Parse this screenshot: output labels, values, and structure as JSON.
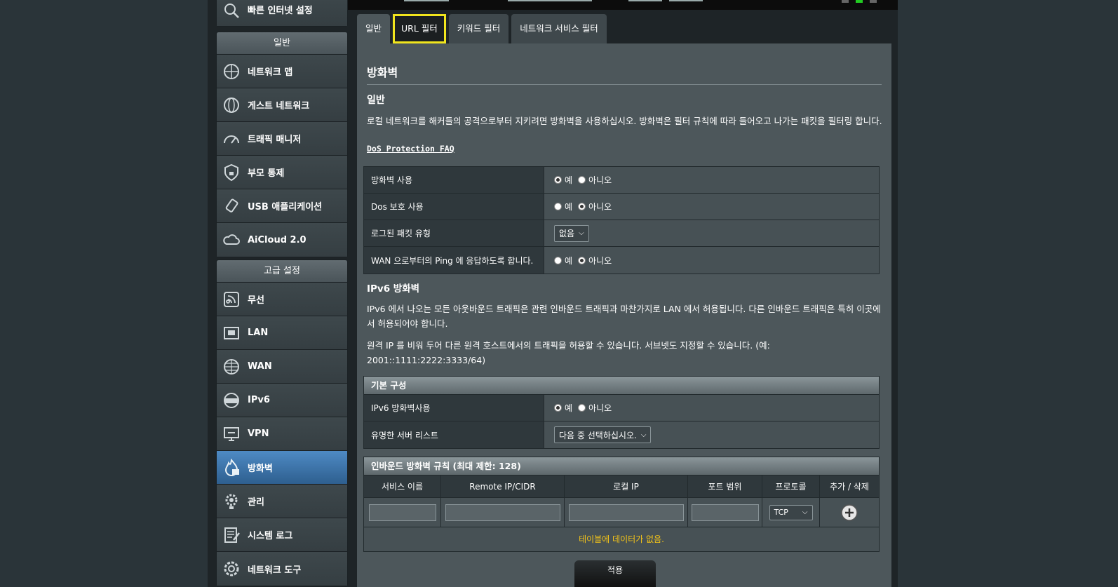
{
  "sidebar": {
    "top_item": "빠른 인터넷 설정",
    "general_head": "일반",
    "general_items": [
      "네트워크 맵",
      "게스트 네트워크",
      "트래픽 매니저",
      "부모 통제",
      "USB 애플리케이션",
      "AiCloud 2.0"
    ],
    "advanced_head": "고급 설정",
    "advanced_items": [
      "무선",
      "LAN",
      "WAN",
      "IPv6",
      "VPN",
      "방화벽",
      "관리",
      "시스템 로그",
      "네트워크 도구"
    ]
  },
  "tabs": [
    "일반",
    "URL 필터",
    "키워드 필터",
    "네트워크 서비스 필터"
  ],
  "firewall": {
    "title": "방화벽",
    "subtitle": "일반",
    "description": "로컬 네트워크를 해커들의 공격으로부터 지키려면 방화벽을 사용하십시오. 방화벽은 필터 규칙에 따라 들어오고 나가는 패킷을 필터링 합니다.",
    "faq_link": "DoS Protection FAQ",
    "yes": "예",
    "no": "아니오",
    "rows": {
      "enable": "방화벽 사용",
      "dos": "Dos 보호 사용",
      "log_type": "로그된 패킷 유형",
      "log_value": "없음",
      "ping": "WAN 으로부터의 Ping 에 응답하도록 합니다."
    }
  },
  "ipv6": {
    "title": "IPv6 방화벽",
    "desc1": "IPv6 에서 나오는 모든 아웃바운드 트래픽은 관련 인바운드 트래픽과 마찬가지로 LAN 에서 허용됩니다. 다른 인바운드 트래픽은 특히 이곳에서 허용되어야 합니다.",
    "desc2": "원격 IP 를 비워 두어 다른 원격 호스트에서의 트래픽을 허용할 수 있습니다. 서브넷도 지정할 수 있습니다. (예: 2001::1111:2222:3333/64)",
    "basic_head": "기본 구성",
    "enable_label": "IPv6 방화벽사용",
    "server_list_label": "유명한 서버 리스트",
    "server_list_value": "다음 중 선택하십시오.",
    "inbound_head": "인바운드 방화벽 규칙 (최대 제한: 128)",
    "columns": [
      "서비스 이름",
      "Remote IP/CIDR",
      "로컬 IP",
      "포트 범위",
      "프로토콜",
      "추가 / 삭제"
    ],
    "protocol_value": "TCP",
    "empty_text": "테이블에 데이터가 없음."
  },
  "apply_label": "적용"
}
